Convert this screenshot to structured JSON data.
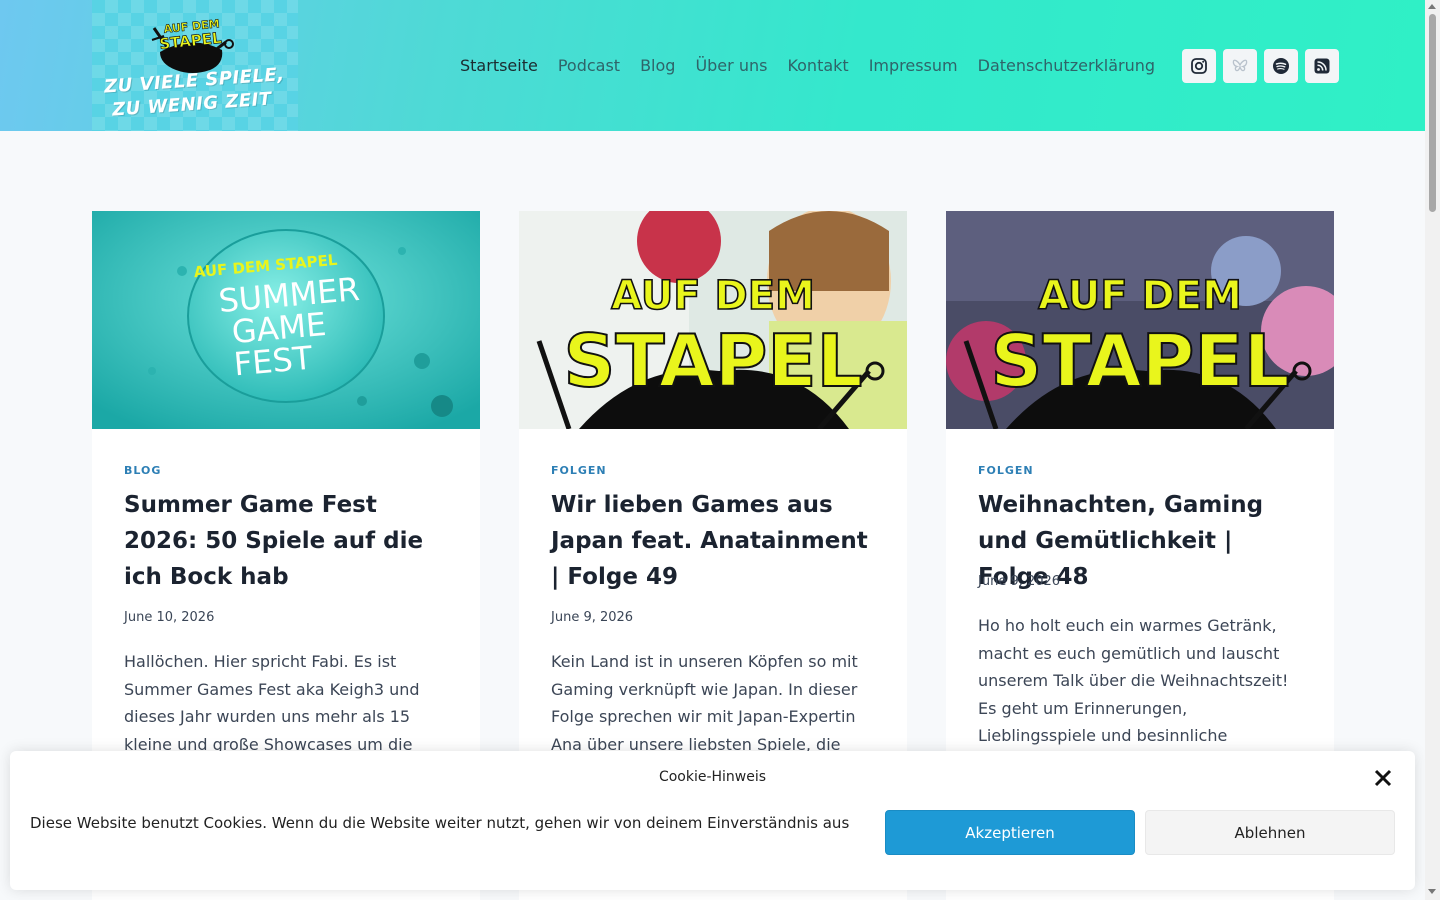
{
  "logo": {
    "brand_line1": "AUF DEM",
    "brand_line2": "STAPEL",
    "tagline_line1": "ZU VIELE SPIELE,",
    "tagline_line2": "ZU WENIG ZEIT"
  },
  "nav": {
    "items": [
      {
        "label": "Startseite",
        "active": true
      },
      {
        "label": "Podcast"
      },
      {
        "label": "Blog"
      },
      {
        "label": "Über uns"
      },
      {
        "label": "Kontakt"
      },
      {
        "label": "Impressum"
      },
      {
        "label": "Datenschutzerklärung"
      }
    ]
  },
  "social": {
    "icons": [
      "instagram-icon",
      "bluesky-icon",
      "spotify-icon",
      "rss-icon"
    ]
  },
  "posts": [
    {
      "image_text": {
        "top": "AUF DEM STAPEL",
        "line1": "SUMMER",
        "line2": "GAME",
        "line3": "FEST"
      },
      "category": "BLOG",
      "title": "Summer Game Fest 2026: 50 Spiele auf die ich Bock hab",
      "date": "June 10, 2026",
      "excerpt": "Hallöchen. Hier spricht Fabi. Es ist Summer Games Fest aka Keigh3 und dieses Jahr wurden uns mehr als 15 kleine und große Showcases um die"
    },
    {
      "image_text": {
        "line1": "AUF DEM",
        "line2": "STAPEL"
      },
      "category": "FOLGEN",
      "title": "Wir lieben Games aus Japan feat. Anatainment | Folge 49",
      "date": "June 9, 2026",
      "excerpt": "Kein Land ist in unseren Köpfen so mit Gaming verknüpft wie Japan. In dieser Folge sprechen wir mit Japan-Expertin Ana über unsere liebsten Spiele, die"
    },
    {
      "image_text": {
        "line1": "AUF DEM",
        "line2": "STAPEL"
      },
      "category": "FOLGEN",
      "title": "Weihnachten, Gaming und Gemütlichkeit | Folge 48",
      "date": "June 9, 2026",
      "excerpt": "Ho ho holt euch ein warmes Getränk, macht es euch gemütlich und lauscht unserem Talk über die Weihnachtszeit! Es geht um Erinnerungen, Lieblingsspiele und besinnliche"
    }
  ],
  "cookie": {
    "title": "Cookie-Hinweis",
    "text": "Diese Website benutzt Cookies. Wenn du die Website weiter nutzt, gehen wir von deinem Einverständnis aus",
    "accept_label": "Akzeptieren",
    "decline_label": "Ablehnen"
  },
  "colors": {
    "accent": "#1e9ad6",
    "brand_yellow": "#e9f51c",
    "category": "#2d7fb5"
  }
}
